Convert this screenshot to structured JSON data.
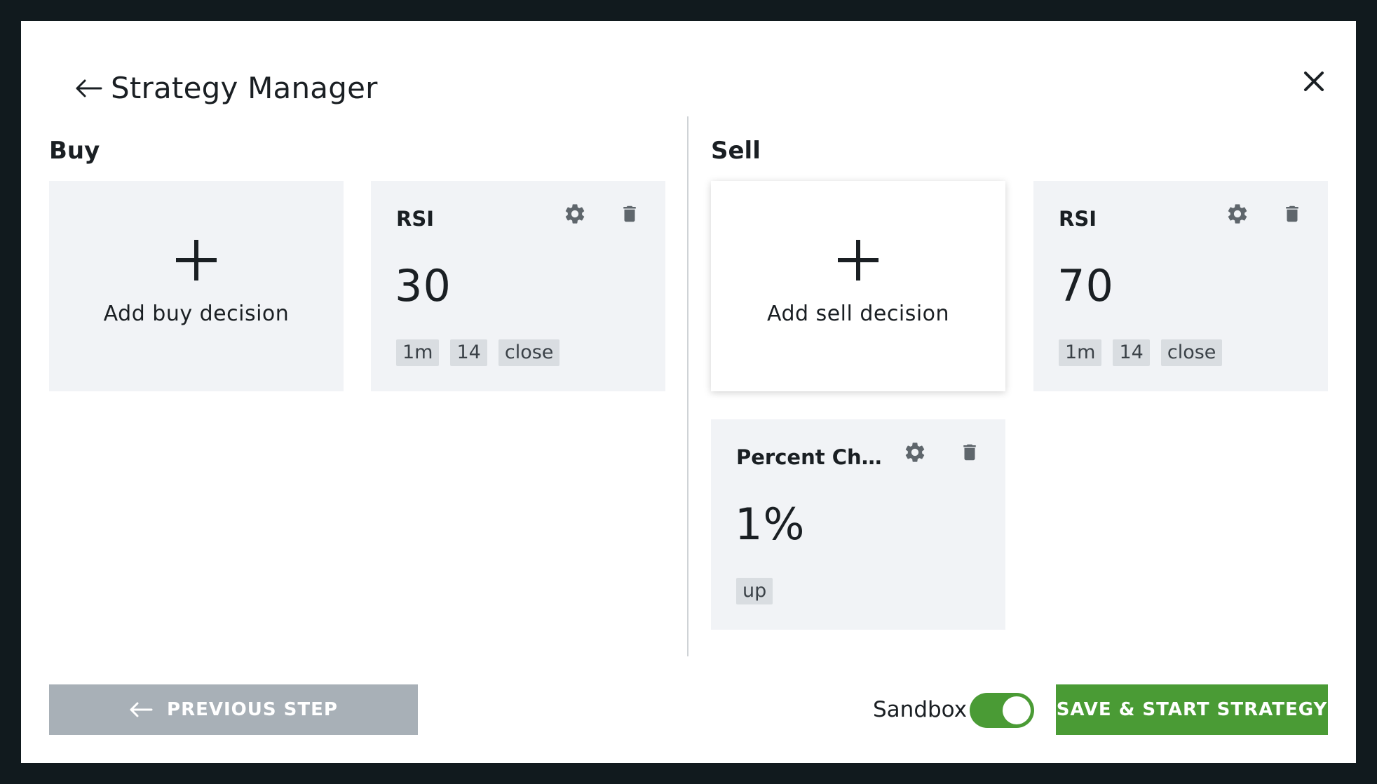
{
  "header": {
    "title": "Strategy Manager"
  },
  "buy": {
    "section_label": "Buy",
    "add_label": "Add buy decision",
    "decisions": [
      {
        "name": "RSI",
        "value": "30",
        "tags": [
          "1m",
          "14",
          "close"
        ]
      }
    ]
  },
  "sell": {
    "section_label": "Sell",
    "add_label": "Add sell decision",
    "decisions": [
      {
        "name": "RSI",
        "value": "70",
        "tags": [
          "1m",
          "14",
          "close"
        ]
      },
      {
        "name": "Percent Ch...",
        "value": "1%",
        "tags": [
          "up"
        ]
      }
    ]
  },
  "footer": {
    "previous_label": "PREVIOUS STEP",
    "sandbox_label": "Sandbox",
    "sandbox_enabled": true,
    "save_label": "SAVE & START STRATEGY"
  },
  "colors": {
    "accent_green": "#4a9b35",
    "disabled_gray": "#a8b0b7",
    "card_bg": "#f1f3f6",
    "icon_gray": "#5f666c"
  },
  "icons": {
    "back": "arrow-left-icon",
    "close": "close-icon",
    "plus": "plus-icon",
    "settings": "gear-icon",
    "delete": "trash-icon"
  }
}
